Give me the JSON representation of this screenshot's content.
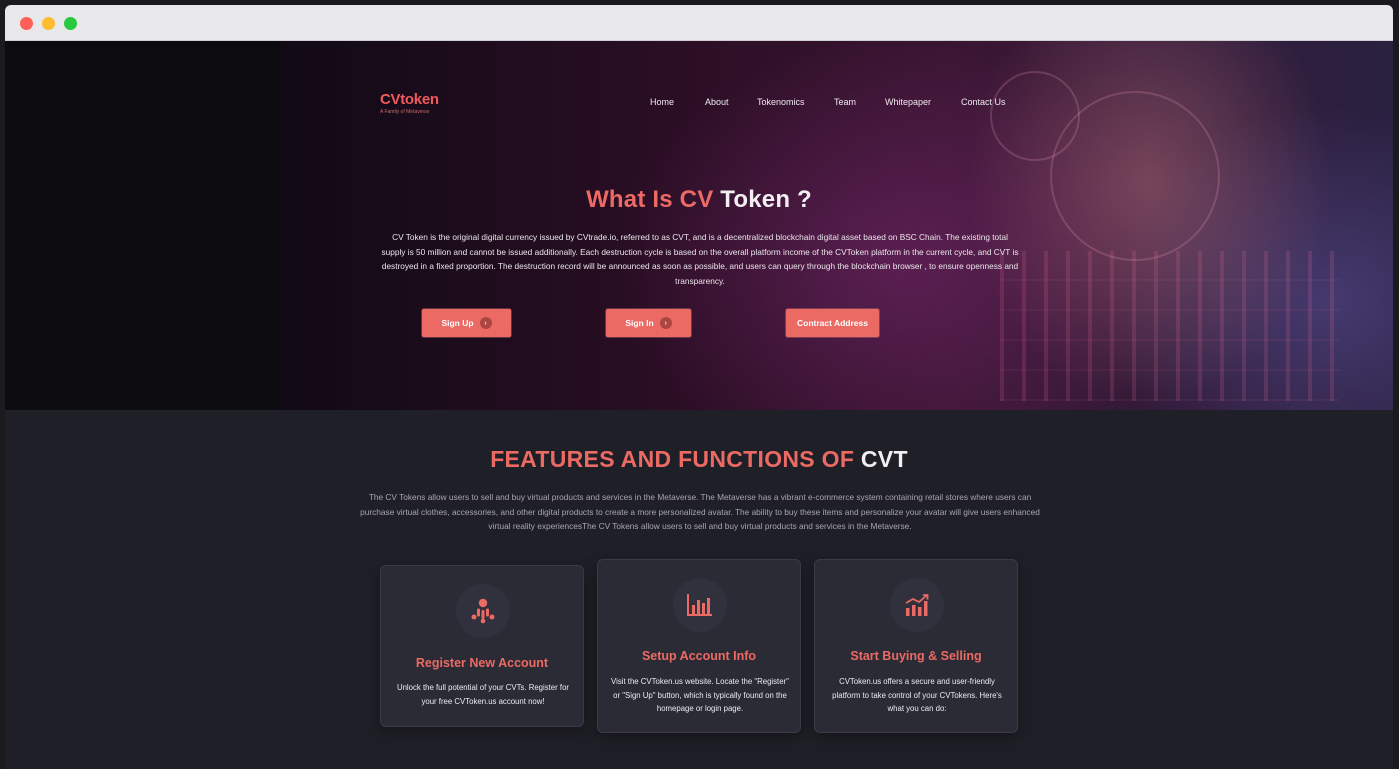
{
  "browser": {
    "buttons": [
      "close",
      "minimize",
      "maximize"
    ]
  },
  "header": {
    "logo": {
      "word": "CVtoken",
      "tagline": "A Family of Metaverse"
    },
    "nav": [
      "Home",
      "About",
      "Tokenomics",
      "Team",
      "Whitepaper",
      "Contact Us"
    ]
  },
  "hero": {
    "title_red": "What Is CV",
    "title_white": "Token ?",
    "description": "CV Token is the original digital currency issued by CVtrade.io, referred to as CVT, and is a decentralized blockchain digital asset based on BSC Chain. The existing total supply is 50 million and cannot be issued additionally. Each destruction cycle is based on the overall platform income of the CVToken platform in the current cycle, and CVT is destroyed in a fixed proportion. The destruction record will be announced as soon as possible, and users can query through the blockchain browser , to ensure openness and transparency.",
    "buttons": {
      "sign_up": "Sign Up",
      "sign_in": "Sign In",
      "contract": "Contract Address"
    }
  },
  "features": {
    "title_red": "FEATURES AND FUNCTIONS OF",
    "title_white": "CVT",
    "description": "The CV Tokens allow users to sell and buy virtual products and services in the Metaverse. The Metaverse has a vibrant e-commerce system containing retail stores where users can purchase virtual clothes, accessories, and other digital products to create a more personalized avatar. The ability to buy these items and personalize your avatar will give users enhanced virtual reality experiencesThe CV Tokens allow users to sell and buy virtual products and services in the Metaverse.",
    "cards": [
      {
        "icon": "users-network-icon",
        "title": "Register New Account",
        "text": "Unlock the full potential of your CVTs. Register for your free CVToken.us account now!"
      },
      {
        "icon": "bar-chart-icon",
        "title": "Setup Account Info",
        "text": "Visit the CVToken.us website. Locate the \"Register\" or \"Sign Up\" button, which is typically found on the homepage or login page."
      },
      {
        "icon": "growth-chart-icon",
        "title": "Start Buying & Selling",
        "text": "CVToken.us offers a secure and user-friendly platform to take control of your CVTokens. Here's what you can do:"
      }
    ]
  },
  "colors": {
    "accent": "#ec6a64",
    "background": "#1f1f27",
    "card": "#2a2b35"
  }
}
